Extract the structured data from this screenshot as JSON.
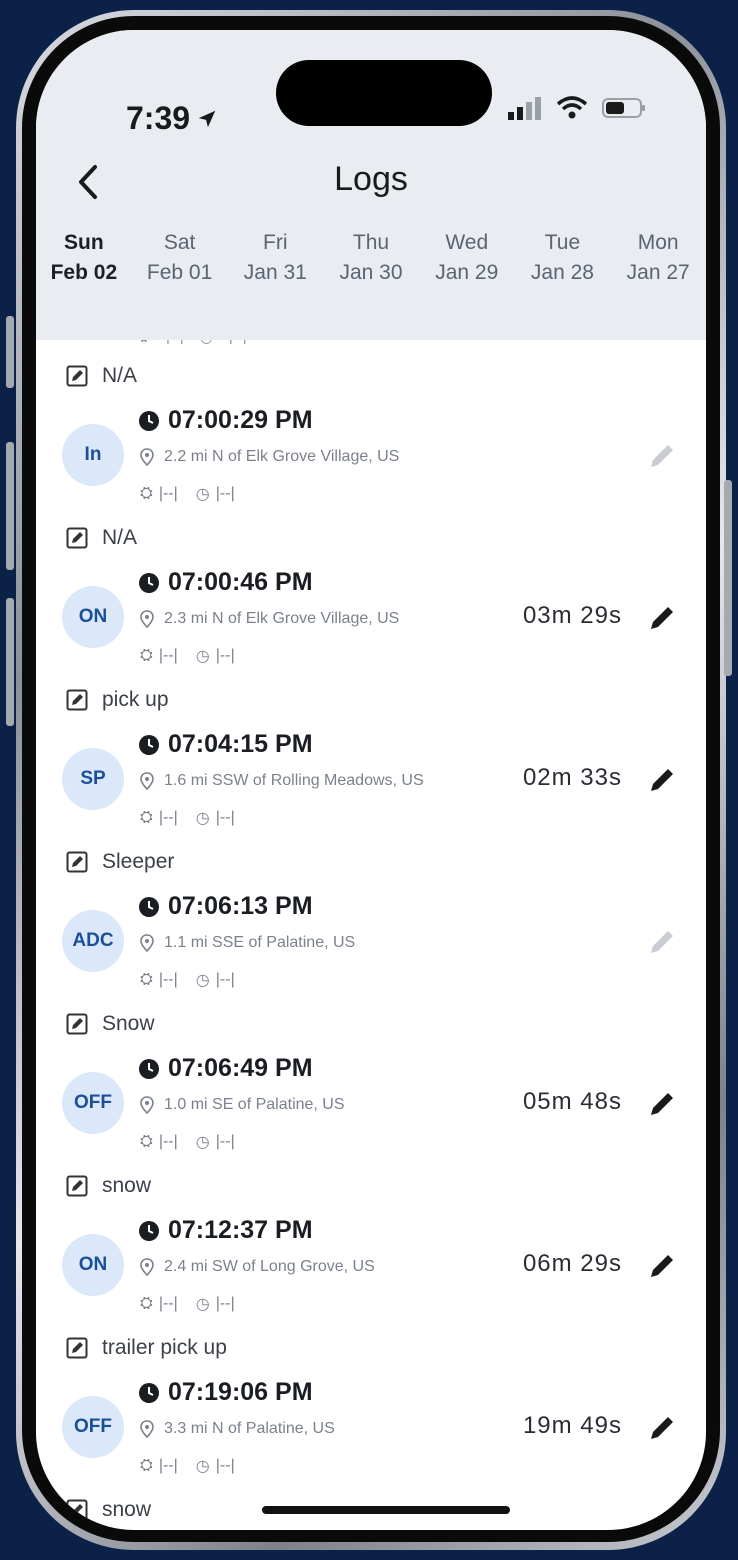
{
  "status_bar": {
    "time": "7:39"
  },
  "header": {
    "title": "Logs"
  },
  "days": [
    {
      "weekday": "Sun",
      "date": "Feb 02",
      "active": true
    },
    {
      "weekday": "Sat",
      "date": "Feb 01",
      "active": false
    },
    {
      "weekday": "Fri",
      "date": "Jan 31",
      "active": false
    },
    {
      "weekday": "Thu",
      "date": "Jan 30",
      "active": false
    },
    {
      "weekday": "Wed",
      "date": "Jan 29",
      "active": false
    },
    {
      "weekday": "Tue",
      "date": "Jan 28",
      "active": false
    },
    {
      "weekday": "Mon",
      "date": "Jan 27",
      "active": false
    }
  ],
  "partial_meta": {
    "odometer": "|--|",
    "engine_hours": "|--|"
  },
  "notes": [
    "N/A",
    "N/A",
    "pick up",
    "Sleeper",
    "Snow",
    "snow",
    "trailer pick up",
    "snow"
  ],
  "entries": [
    {
      "status": "In",
      "time": "07:00:29 PM",
      "location": "2.2 mi N of Elk Grove Village, US",
      "odometer": "|--|",
      "engine_hours": "|--|",
      "duration": "",
      "editable": false
    },
    {
      "status": "ON",
      "time": "07:00:46 PM",
      "location": "2.3 mi N of Elk Grove Village, US",
      "odometer": "|--|",
      "engine_hours": "|--|",
      "duration": "03m 29s",
      "editable": true
    },
    {
      "status": "SP",
      "time": "07:04:15 PM",
      "location": "1.6 mi SSW of Rolling Meadows, US",
      "odometer": "|--|",
      "engine_hours": "|--|",
      "duration": "02m 33s",
      "editable": true
    },
    {
      "status": "ADC",
      "time": "07:06:13 PM",
      "location": "1.1 mi SSE of Palatine, US",
      "odometer": "|--|",
      "engine_hours": "|--|",
      "duration": "",
      "editable": false
    },
    {
      "status": "OFF",
      "time": "07:06:49 PM",
      "location": "1.0 mi SE of Palatine, US",
      "odometer": "|--|",
      "engine_hours": "|--|",
      "duration": "05m 48s",
      "editable": true
    },
    {
      "status": "ON",
      "time": "07:12:37 PM",
      "location": "2.4 mi SW of Long Grove, US",
      "odometer": "|--|",
      "engine_hours": "|--|",
      "duration": "06m 29s",
      "editable": true
    },
    {
      "status": "OFF",
      "time": "07:19:06 PM",
      "location": "3.3 mi N of Palatine, US",
      "odometer": "|--|",
      "engine_hours": "|--|",
      "duration": "19m 49s",
      "editable": true
    }
  ],
  "colors": {
    "background": "#0b2147",
    "header": "#e9ecf1",
    "badge_bg": "#dbe8fa",
    "badge_text": "#1c4f9a",
    "edit_active": "#1a1a1a",
    "edit_disabled": "#c9ccd2"
  }
}
